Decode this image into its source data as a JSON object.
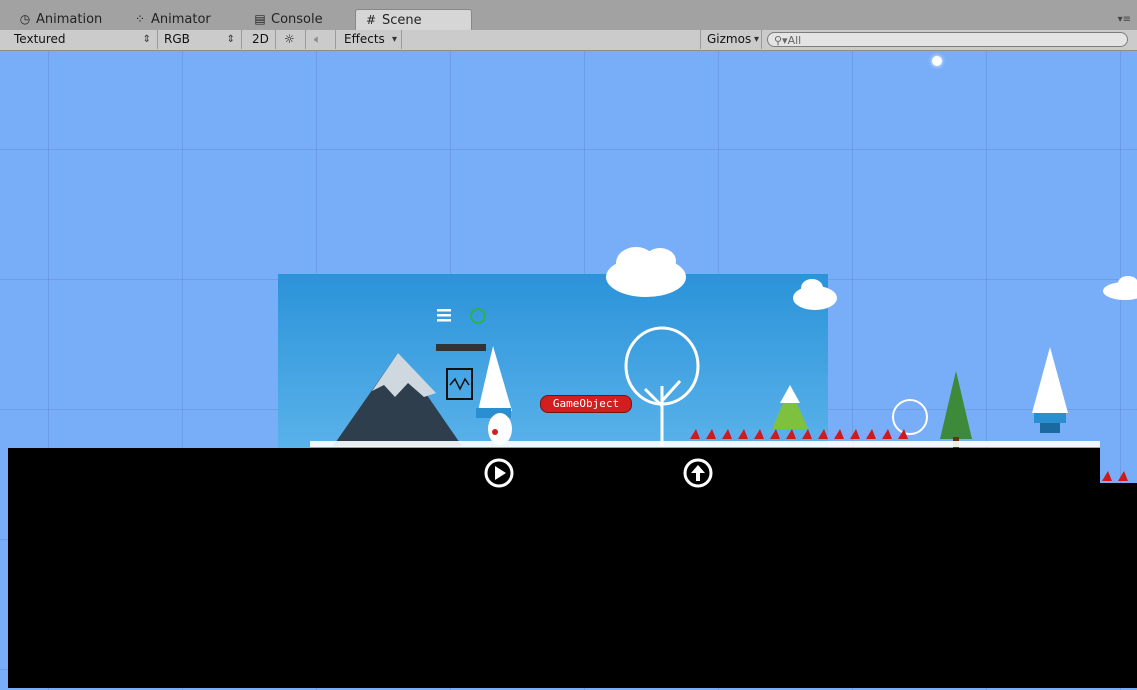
{
  "tabs": [
    {
      "label": "Animation",
      "icon": "clock-icon",
      "glyph": "◷"
    },
    {
      "label": "Animator",
      "icon": "animator-icon",
      "glyph": "⁘"
    },
    {
      "label": "Console",
      "icon": "console-icon",
      "glyph": "▤"
    },
    {
      "label": "Scene",
      "icon": "grid-icon",
      "glyph": "#"
    }
  ],
  "toolbar": {
    "shading": "Textured",
    "channels": "RGB",
    "mode2d": "2D",
    "effects": "Effects",
    "gizmos": "Gizmos",
    "search_placeholder": "All"
  },
  "scene": {
    "object_label": "GameObject"
  },
  "colors": {
    "sky": "#78aef8",
    "camera_frame": "#2b93d9",
    "label_red": "#d21e1e"
  }
}
